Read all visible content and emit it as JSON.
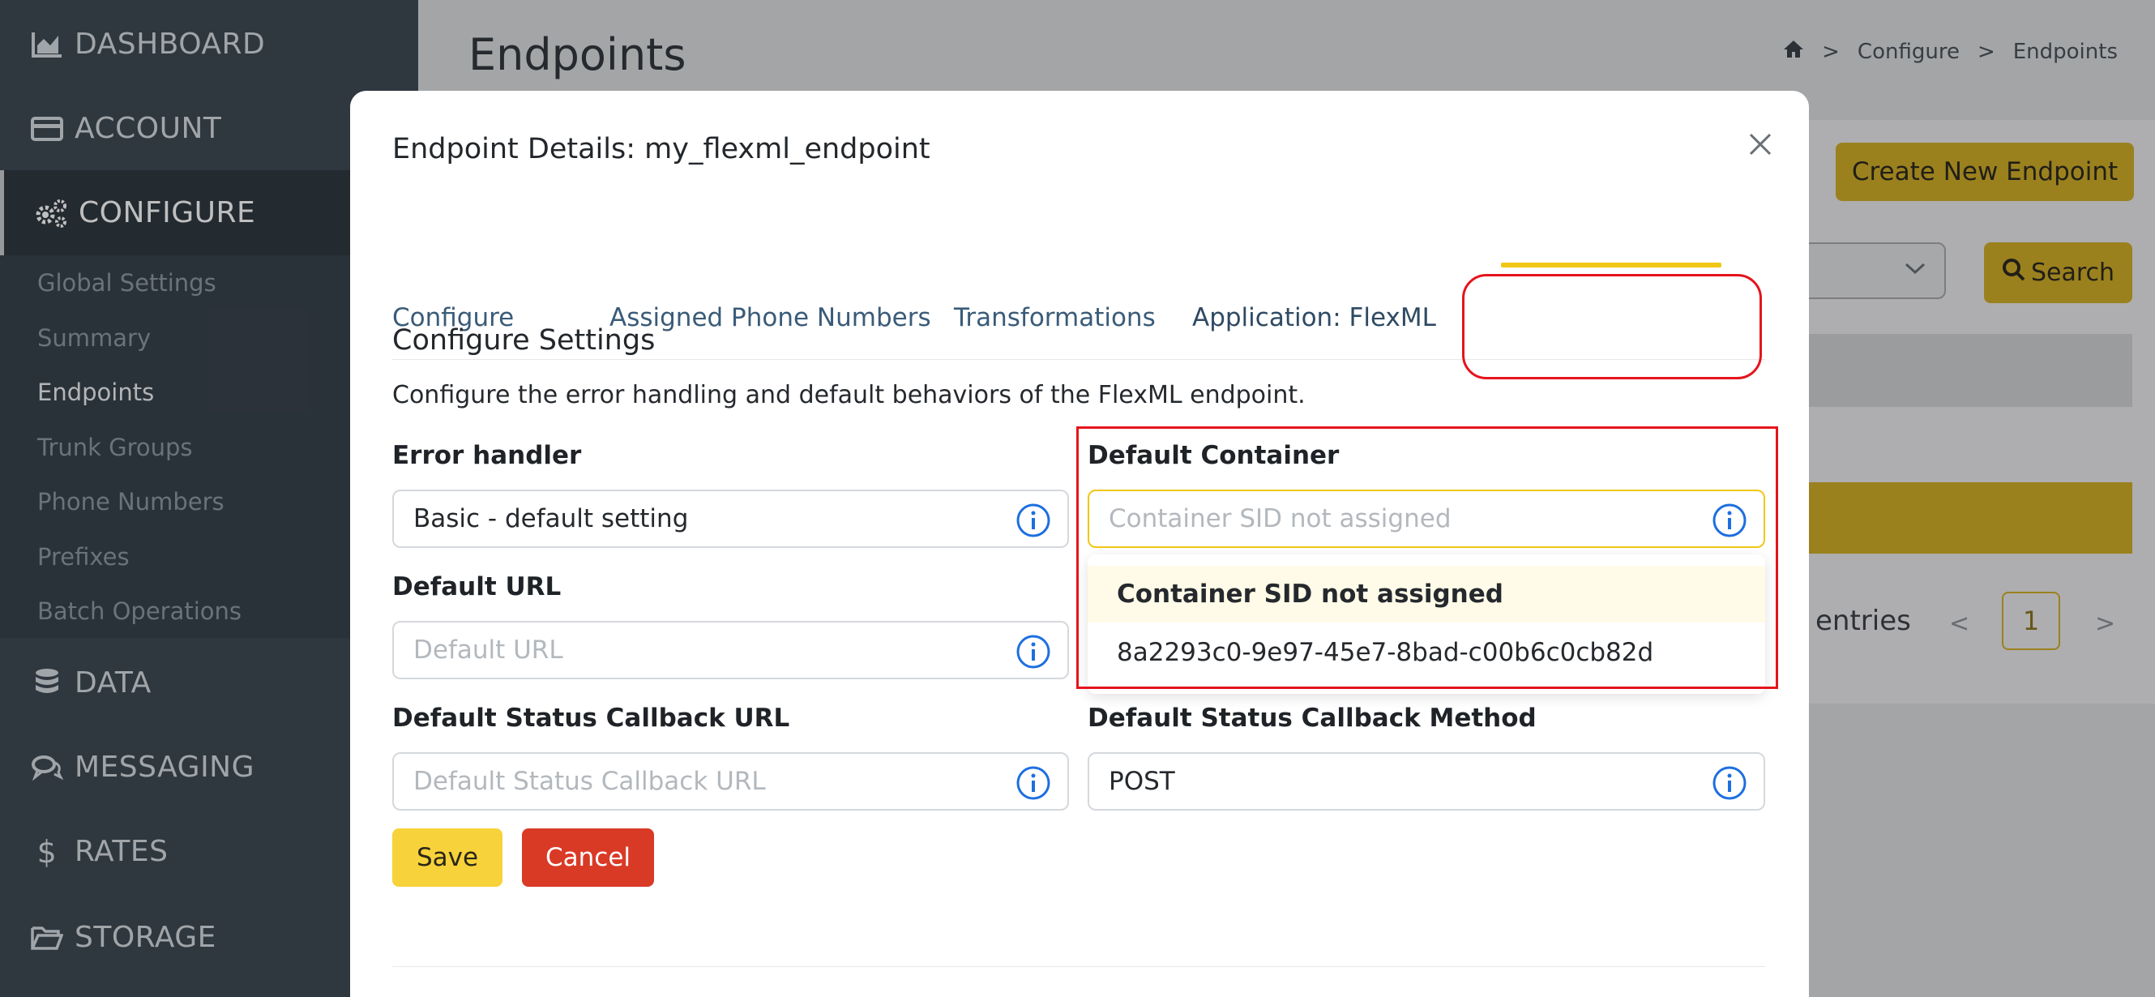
{
  "sidebar": {
    "dashboard": "DASHBOARD",
    "account": "ACCOUNT",
    "configure": "CONFIGURE",
    "sub_items": [
      "Global Settings",
      "Summary",
      "Endpoints",
      "Trunk Groups",
      "Phone Numbers",
      "Prefixes",
      "Batch Operations"
    ],
    "data": "DATA",
    "messaging": "MESSAGING",
    "rates": "RATES",
    "storage": "STORAGE"
  },
  "page": {
    "title": "Endpoints",
    "breadcrumb": [
      ">",
      "Configure",
      ">",
      "Endpoints"
    ],
    "create_button": "Create New Endpoint",
    "search_button": "Search",
    "entries_text": "entries",
    "pager_prev": "<",
    "pager_current": "1",
    "pager_next": ">"
  },
  "modal": {
    "title": "Endpoint Details: my_flexml_endpoint",
    "tabs": [
      "Configure",
      "Assigned Phone Numbers",
      "Transformations",
      "Application: FlexML"
    ],
    "section_title": "Configure Settings",
    "section_desc": "Configure the error handling and default behaviors of the FlexML endpoint.",
    "error_handler": {
      "label": "Error handler",
      "value": "Basic - default setting"
    },
    "default_container": {
      "label": "Default Container",
      "placeholder": "Container SID not assigned"
    },
    "container_options": [
      "Container SID not assigned",
      "8a2293c0-9e97-45e7-8bad-c00b6c0cb82d"
    ],
    "default_url": {
      "label": "Default URL",
      "placeholder": "Default URL"
    },
    "status_callback_url": {
      "label": "Default Status Callback URL",
      "placeholder": "Default Status Callback URL"
    },
    "status_callback_method": {
      "label": "Default Status Callback Method",
      "value": "POST"
    },
    "save": "Save",
    "cancel": "Cancel"
  },
  "colors": {
    "accent": "#f1c716",
    "danger": "#d93a26",
    "highlight": "#e5141c",
    "sidebar": "#3f4a54"
  },
  "icons": [
    "dashboard-icon",
    "account-icon",
    "configure-icon",
    "data-icon",
    "messaging-icon",
    "rates-icon",
    "storage-icon",
    "home-icon",
    "close-icon",
    "info-icon",
    "search-icon",
    "chevron-down-icon"
  ]
}
